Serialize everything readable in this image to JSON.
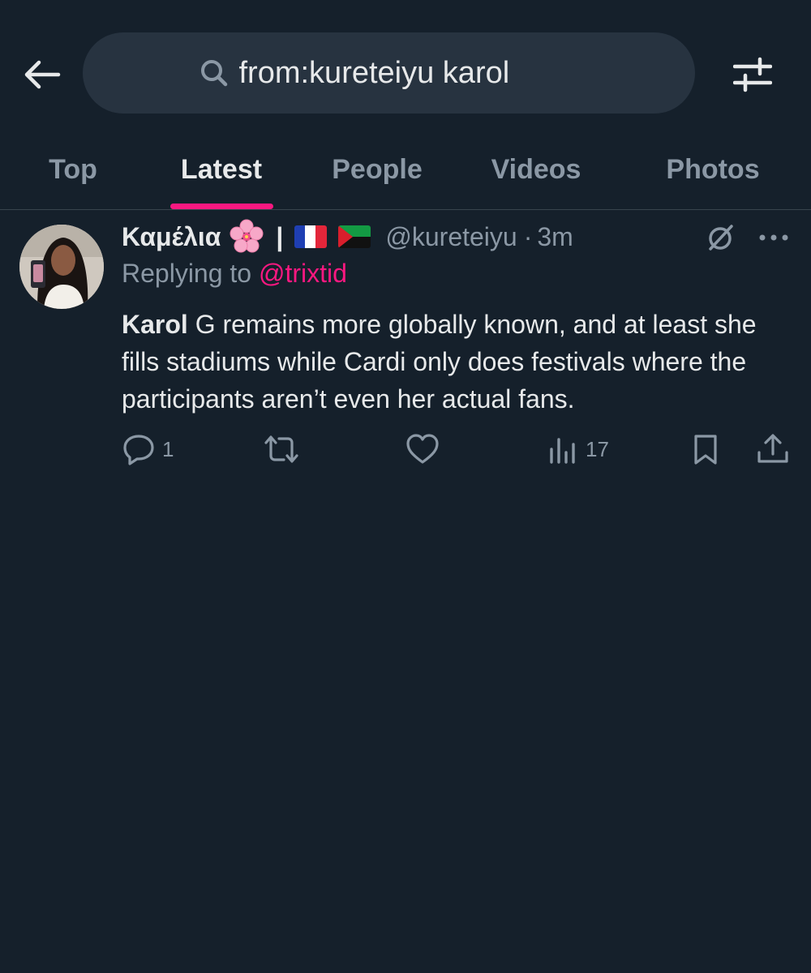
{
  "search": {
    "query": "from:kureteiyu karol"
  },
  "tabs": [
    {
      "label": "Top",
      "active": false
    },
    {
      "label": "Latest",
      "active": true
    },
    {
      "label": "People",
      "active": false
    },
    {
      "label": "Videos",
      "active": false
    },
    {
      "label": "Photos",
      "active": false
    }
  ],
  "tweet": {
    "display_name": "Καμέλια",
    "name_emoji": "cherry-blossom",
    "separator": "|",
    "flags": [
      "flag-france",
      "flag-martinique"
    ],
    "handle": "@kureteiyu",
    "dot": "·",
    "time": "3m",
    "replying_prefix": "Replying to ",
    "replying_to": "@trixtid",
    "text_bold": "Karol",
    "text_rest": " G remains more globally known, and at least she fills stadiums while Cardi only does festivals where the participants aren’t even her actual fans.",
    "actions": {
      "reply_count": "1",
      "retweet_count": "",
      "like_count": "",
      "views_count": "17"
    }
  },
  "colors": {
    "background": "#15202b",
    "accent": "#f91880",
    "muted": "#8b98a5",
    "text": "#e7e9ea"
  }
}
